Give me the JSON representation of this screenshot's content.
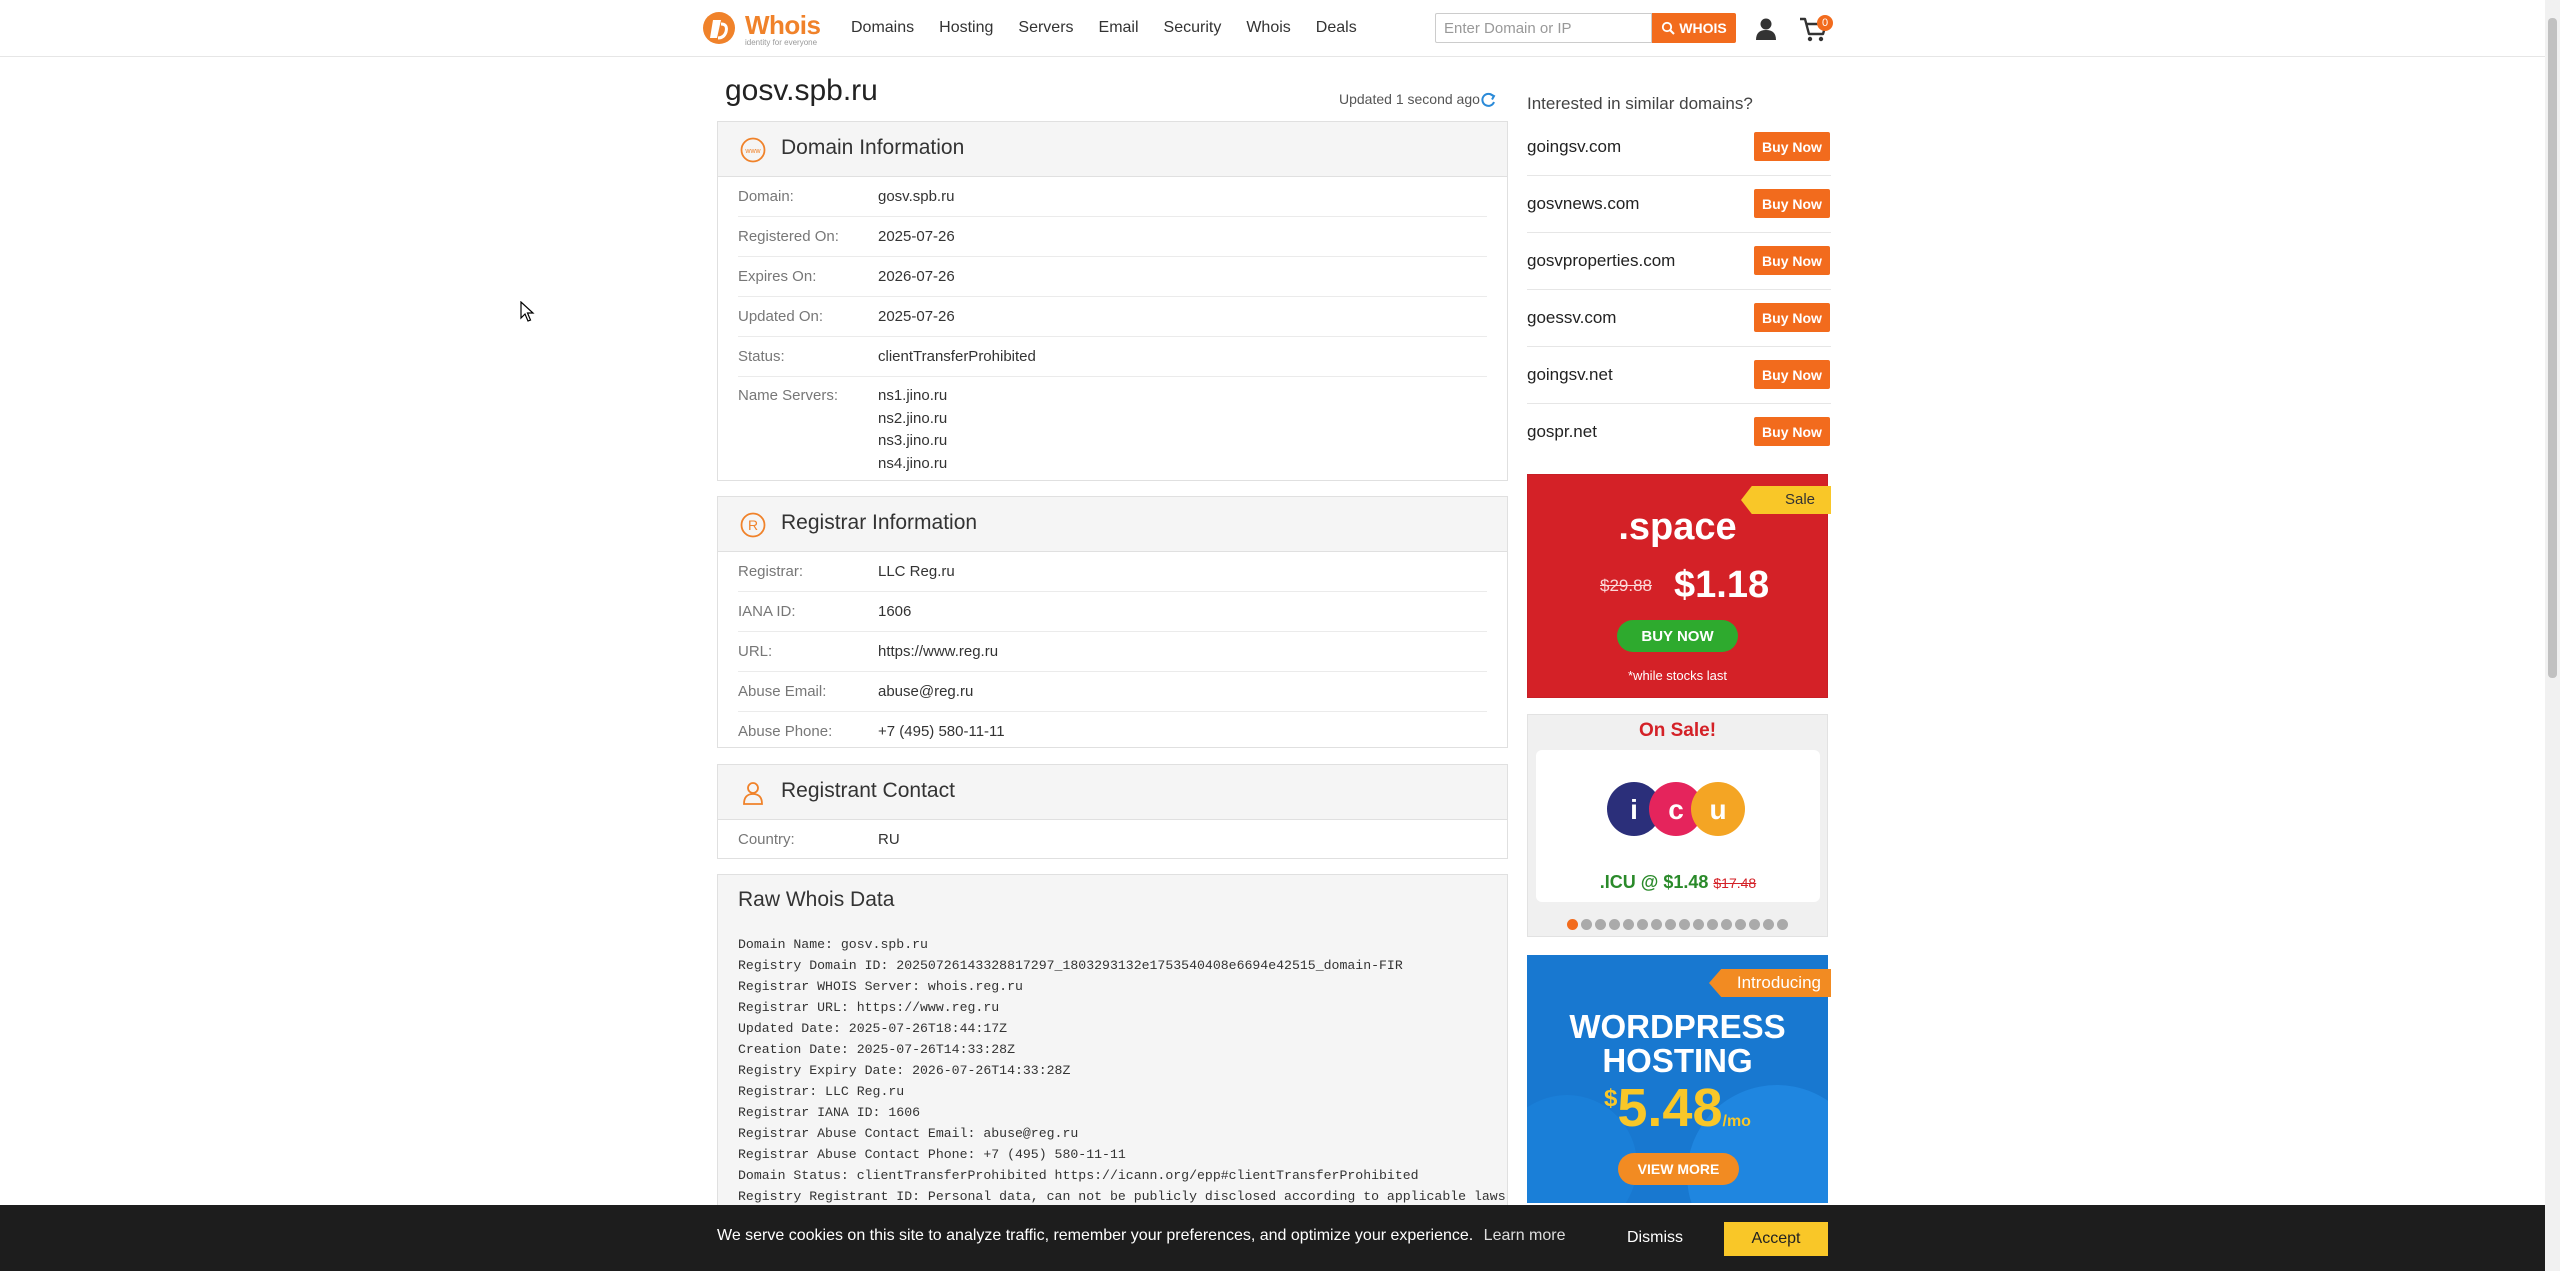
{
  "header": {
    "logo_text": "Whois",
    "logo_tagline": "identity for everyone",
    "nav": [
      "Domains",
      "Hosting",
      "Servers",
      "Email",
      "Security",
      "Whois",
      "Deals"
    ],
    "search_placeholder": "Enter Domain or IP",
    "search_button": "WHOIS",
    "cart_count": "0"
  },
  "page": {
    "title": "gosv.spb.ru",
    "updated": "Updated 1 second ago"
  },
  "domain_info": {
    "title": "Domain Information",
    "rows": [
      {
        "label": "Domain:",
        "value": "gosv.spb.ru"
      },
      {
        "label": "Registered On:",
        "value": "2025-07-26"
      },
      {
        "label": "Expires On:",
        "value": "2026-07-26"
      },
      {
        "label": "Updated On:",
        "value": "2025-07-26"
      },
      {
        "label": "Status:",
        "value": "clientTransferProhibited"
      }
    ],
    "name_servers_label": "Name Servers:",
    "name_servers": [
      "ns1.jino.ru",
      "ns2.jino.ru",
      "ns3.jino.ru",
      "ns4.jino.ru"
    ]
  },
  "registrar_info": {
    "title": "Registrar Information",
    "rows": [
      {
        "label": "Registrar:",
        "value": "LLC Reg.ru"
      },
      {
        "label": "IANA ID:",
        "value": "1606"
      },
      {
        "label": "URL:",
        "value": "https://www.reg.ru"
      },
      {
        "label": "Abuse Email:",
        "value": "abuse@reg.ru"
      },
      {
        "label": "Abuse Phone:",
        "value": "+7 (495) 580-11-11"
      }
    ]
  },
  "registrant": {
    "title": "Registrant Contact",
    "rows": [
      {
        "label": "Country:",
        "value": "RU"
      }
    ]
  },
  "raw": {
    "title": "Raw Whois Data",
    "lines": [
      "Domain Name: gosv.spb.ru",
      "Registry Domain ID: 20250726143328817297_1803293132e1753540408e6694e42515_domain-FIR",
      "Registrar WHOIS Server: whois.reg.ru",
      "Registrar URL: https://www.reg.ru",
      "Updated Date: 2025-07-26T18:44:17Z",
      "Creation Date: 2025-07-26T14:33:28Z",
      "Registry Expiry Date: 2026-07-26T14:33:28Z",
      "Registrar: LLC Reg.ru",
      "Registrar IANA ID: 1606",
      "Registrar Abuse Contact Email: abuse@reg.ru",
      "Registrar Abuse Contact Phone: +7 (495) 580-11-11",
      "Domain Status: clientTransferProhibited https://icann.org/epp#clientTransferProhibited",
      "Registry Registrant ID: Personal data, can not be publicly disclosed according to applicable laws"
    ]
  },
  "sidebar": {
    "heading": "Interested in similar domains?",
    "buy_label": "Buy Now",
    "suggestions": [
      "goingsv.com",
      "gosvnews.com",
      "gosvproperties.com",
      "goessv.com",
      "goingsv.net",
      "gospr.net"
    ],
    "promo_space": {
      "ribbon": "Sale",
      "tld": ".space",
      "old_price": "$29.88",
      "new_price": "$1.18",
      "button": "BUY NOW",
      "note": "*while stocks last"
    },
    "on_sale": {
      "title": "On Sale!",
      "logo_letters": [
        "i",
        "c",
        "u"
      ],
      "price": ".ICU @ $1.48",
      "old_price": "$17.48",
      "slide_count": 16,
      "active_slide": 1
    },
    "wordpress": {
      "ribbon": "Introducing",
      "title_line1": "WORDPRESS",
      "title_line2": "HOSTING",
      "currency": "$",
      "price": "5.48",
      "period": "/mo",
      "button": "VIEW MORE"
    }
  },
  "cookie": {
    "text": "We serve cookies on this site to analyze traffic, remember your preferences, and optimize your experience.",
    "learn_more": "Learn more",
    "dismiss": "Dismiss",
    "accept": "Accept"
  },
  "colors": {
    "brand_orange": "#f26b1d",
    "sale_red": "#d42127",
    "wp_blue": "#1878d0",
    "accent_yellow": "#f9c728",
    "buy_green": "#2eaa2e"
  }
}
